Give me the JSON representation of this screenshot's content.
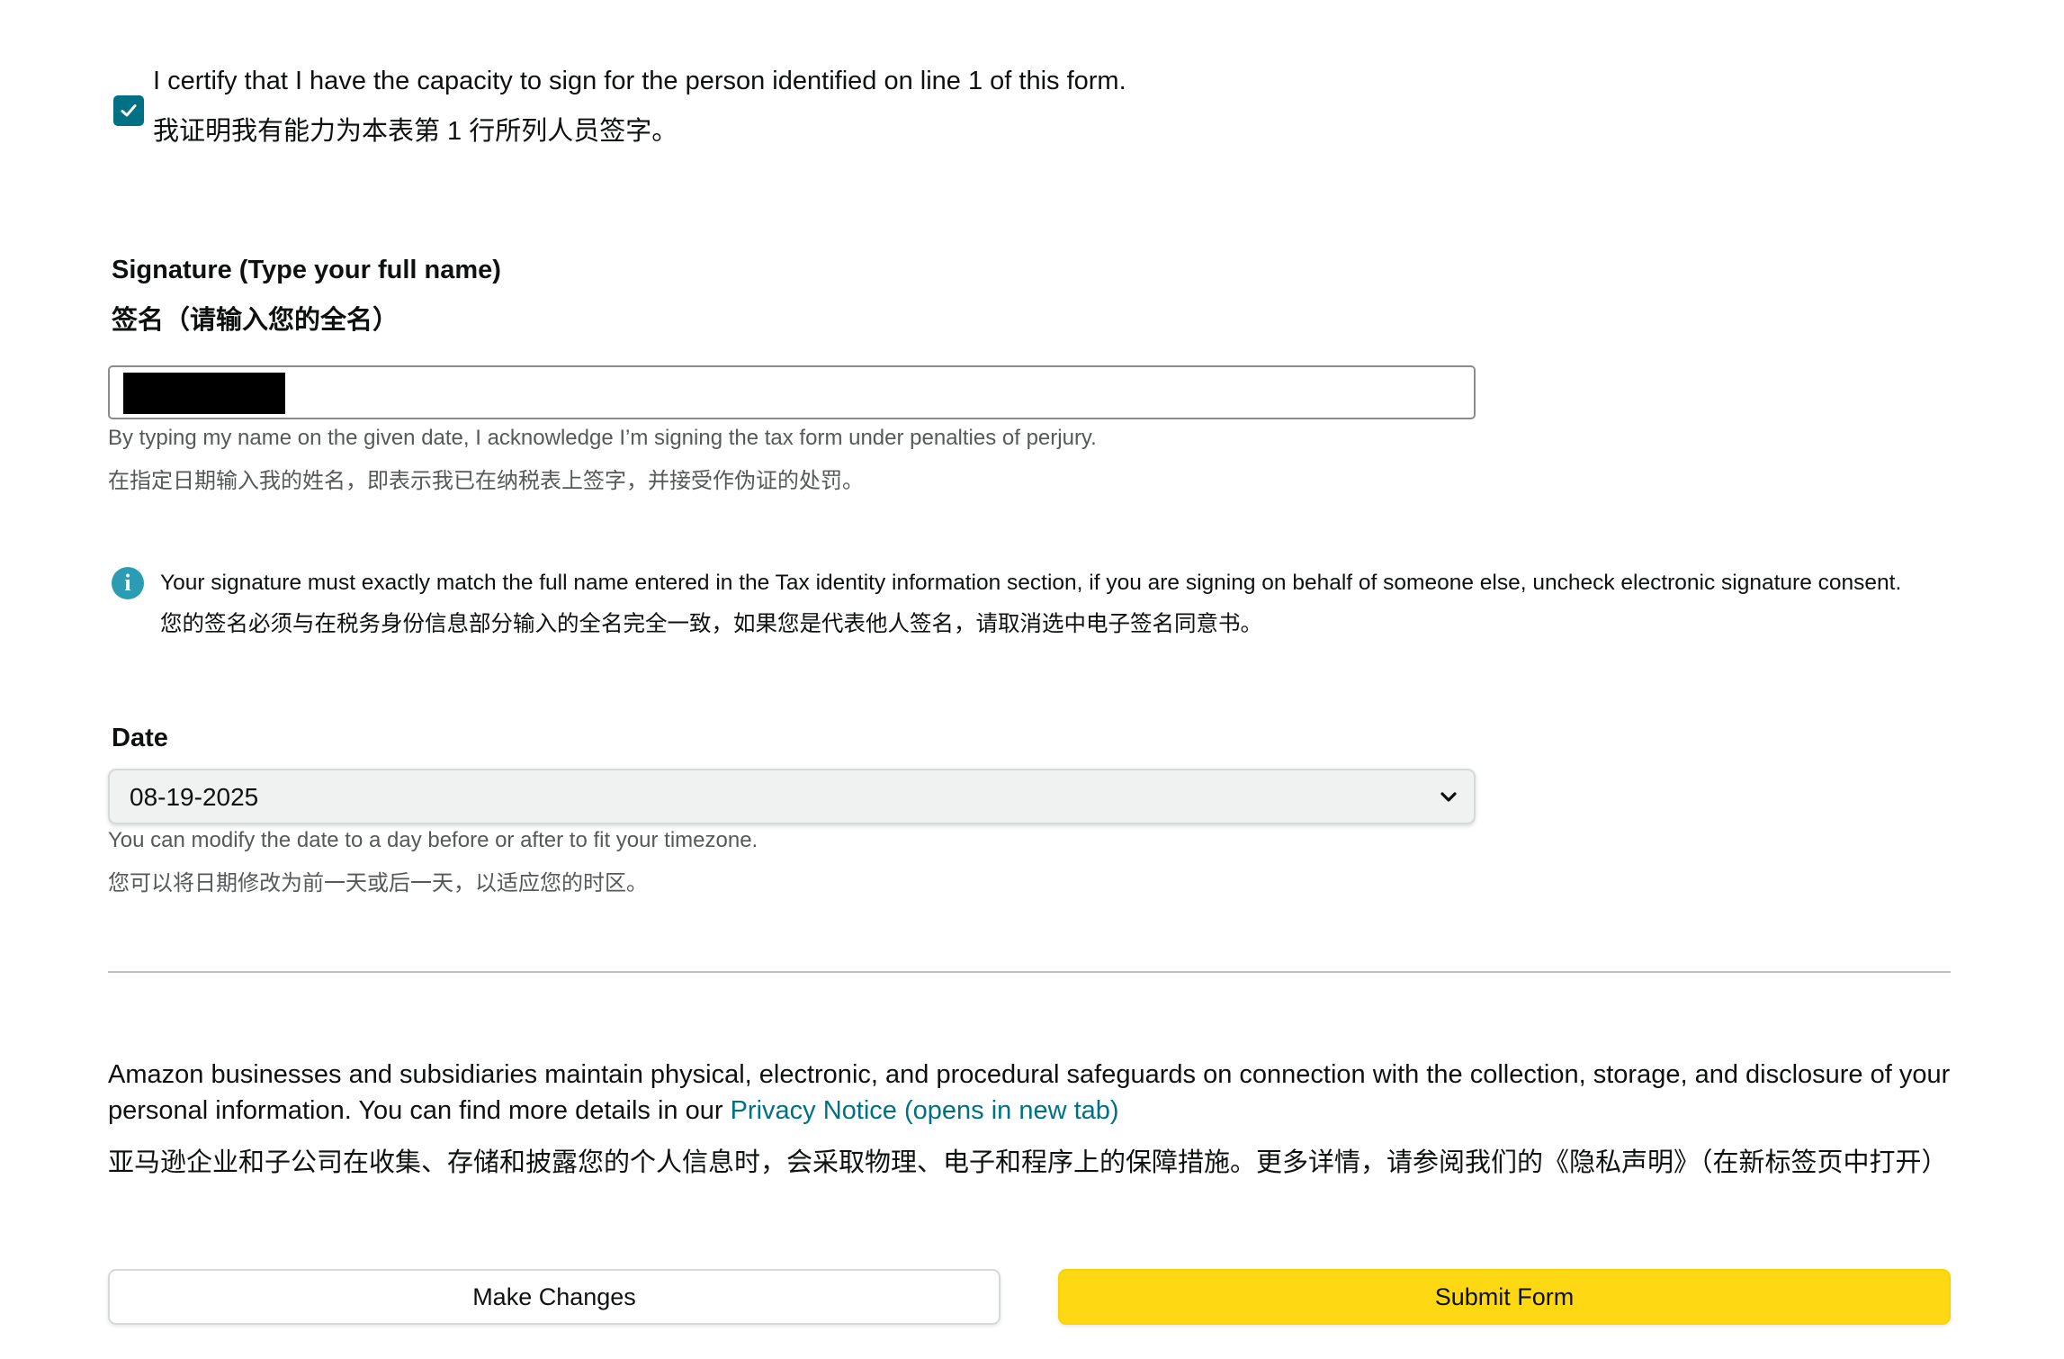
{
  "certify": {
    "checked": true,
    "text_en": "I certify that I have the capacity to sign for the person identified on line 1 of this form.",
    "text_zh": "我证明我有能力为本表第 1 行所列人员签字。"
  },
  "signature": {
    "label_en": "Signature (Type your full name)",
    "label_zh": "签名（请输入您的全名）",
    "value_redacted": true,
    "hint_en": "By typing my name on the given date, I acknowledge I’m signing the tax form under penalties of perjury.",
    "hint_zh": "在指定日期输入我的姓名，即表示我已在纳税表上签字，并接受作伪证的处罚。"
  },
  "info_alert": {
    "icon": "info-icon",
    "icon_glyph": "i",
    "text_en": "Your signature must exactly match the full name entered in the Tax identity information section, if you are signing on behalf of someone else, uncheck electronic signature consent.",
    "text_zh": "您的签名必须与在税务身份信息部分输入的全名完全一致，如果您是代表他人签名，请取消选中电子签名同意书。"
  },
  "date": {
    "label": "Date",
    "selected": "08-19-2025",
    "hint_en": "You can modify the date to a day before or after to fit your timezone.",
    "hint_zh": "您可以将日期修改为前一天或后一天，以适应您的时区。"
  },
  "privacy": {
    "text_en": "Amazon businesses and subsidiaries maintain physical, electronic, and procedural safeguards on connection with the collection, storage, and disclosure of your personal information. You can find more details in our ",
    "link_label": "Privacy Notice (opens in new tab)",
    "text_zh": "亚马逊企业和子公司在收集、存储和披露您的个人信息时，会采取物理、电子和程序上的保障措施。更多详情，请参阅我们的《隐私声明》（在新标签页中打开）"
  },
  "buttons": {
    "make_changes": "Make Changes",
    "submit": "Submit Form"
  },
  "colors": {
    "accent_teal": "#007185",
    "info_blue": "#2a9cb3",
    "primary_yellow": "#ffd814",
    "hint_gray": "#565959"
  }
}
